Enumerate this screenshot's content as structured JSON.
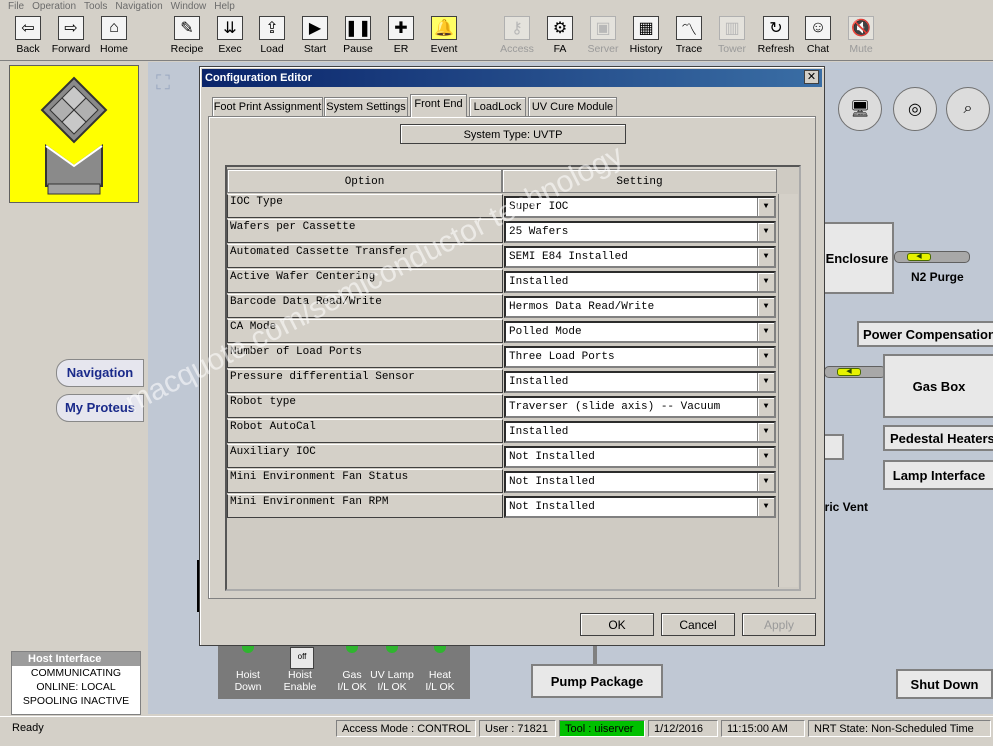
{
  "menu": [
    "File",
    "Operation",
    "Tools",
    "Navigation",
    "Window",
    "Help"
  ],
  "toolbar": [
    {
      "label": "Back",
      "icon": "arrow-left-icon",
      "glyph": "⇦",
      "enabled": true
    },
    {
      "label": "Forward",
      "icon": "arrow-right-icon",
      "glyph": "⇨",
      "enabled": true
    },
    {
      "label": "Home",
      "icon": "home-icon",
      "glyph": "⌂",
      "enabled": true
    },
    {
      "label": "Recipe",
      "icon": "recipe-icon",
      "glyph": "✎",
      "enabled": true
    },
    {
      "label": "Exec",
      "icon": "exec-icon",
      "glyph": "⇊",
      "enabled": true
    },
    {
      "label": "Load",
      "icon": "load-icon",
      "glyph": "⇪",
      "enabled": true
    },
    {
      "label": "Start",
      "icon": "play-icon",
      "glyph": "▶",
      "enabled": true
    },
    {
      "label": "Pause",
      "icon": "pause-icon",
      "glyph": "❚❚",
      "enabled": true
    },
    {
      "label": "ER",
      "icon": "plus-icon",
      "glyph": "✚",
      "enabled": true
    },
    {
      "label": "Event",
      "icon": "bell-icon",
      "glyph": "🔔",
      "enabled": true
    },
    {
      "label": "Access",
      "icon": "key-icon",
      "glyph": "⚷",
      "enabled": false
    },
    {
      "label": "FA",
      "icon": "gear-icon",
      "glyph": "⚙",
      "enabled": true
    },
    {
      "label": "Server",
      "icon": "server-icon",
      "glyph": "▣",
      "enabled": false
    },
    {
      "label": "History",
      "icon": "history-icon",
      "glyph": "▦",
      "enabled": true
    },
    {
      "label": "Trace",
      "icon": "trace-icon",
      "glyph": "〽",
      "enabled": true
    },
    {
      "label": "Tower",
      "icon": "tower-icon",
      "glyph": "▥",
      "enabled": false
    },
    {
      "label": "Refresh",
      "icon": "refresh-icon",
      "glyph": "↻",
      "enabled": true
    },
    {
      "label": "Chat",
      "icon": "chat-icon",
      "glyph": "☺",
      "enabled": true
    },
    {
      "label": "Mute",
      "icon": "mute-icon",
      "glyph": "🔇",
      "enabled": false
    }
  ],
  "left": {
    "nav_buttons": [
      "Navigation",
      "My Proteus"
    ],
    "host_interface": {
      "title": "Host Interface",
      "lines": [
        "COMMUNICATING",
        "ONLINE: LOCAL",
        "SPOOLING INACTIVE"
      ]
    }
  },
  "background": {
    "buttons": [
      "Enclosure",
      "Power Compensation",
      "Gas Box",
      "Pedestal Heaters",
      "Lamp Interface",
      "Pump Package",
      "Shut Down"
    ],
    "labels": [
      "N2 Purge",
      "eric Vent"
    ],
    "leds": [
      {
        "label": "Hoist\nDown"
      },
      {
        "label": "Hoist\nEnable",
        "toggle": "off"
      },
      {
        "label": "Gas\nI/L OK"
      },
      {
        "label": "UV Lamp\nI/L OK"
      },
      {
        "label": "Heat\nI/L OK"
      }
    ]
  },
  "dialog": {
    "title": "Configuration Editor",
    "tabs": [
      "Foot Print Assignment",
      "System Settings",
      "Front End",
      "LoadLock",
      "UV Cure Module"
    ],
    "active_tab": 2,
    "system_type": "System Type: UVTP",
    "columns": [
      "Option",
      "Setting"
    ],
    "rows": [
      {
        "option": "IOC Type",
        "setting": "Super IOC"
      },
      {
        "option": "Wafers per Cassette",
        "setting": "25 Wafers"
      },
      {
        "option": "Automated Cassette Transfer",
        "setting": "SEMI E84 Installed"
      },
      {
        "option": "Active Wafer Centering",
        "setting": "Installed"
      },
      {
        "option": "Barcode Data Read/Write",
        "setting": "Hermos Data Read/Write"
      },
      {
        "option": "CA Mode",
        "setting": "Polled Mode"
      },
      {
        "option": "Number of Load Ports",
        "setting": "Three Load Ports"
      },
      {
        "option": "Pressure differential Sensor",
        "setting": "Installed"
      },
      {
        "option": "Robot type",
        "setting": "Traverser (slide axis) -- Vacuum"
      },
      {
        "option": "Robot AutoCal",
        "setting": "Installed"
      },
      {
        "option": "Auxiliary IOC",
        "setting": "Not Installed"
      },
      {
        "option": "Mini Environment Fan Status",
        "setting": "Not Installed"
      },
      {
        "option": "Mini Environment Fan RPM",
        "setting": "Not Installed"
      }
    ],
    "buttons": {
      "ok": "OK",
      "cancel": "Cancel",
      "apply": "Apply"
    }
  },
  "status": {
    "ready": "Ready",
    "access_mode": "Access Mode : CONTROL",
    "user": "User :  71821",
    "tool": "Tool :   uiserver",
    "date": "1/12/2016",
    "time": "11:15:00 AM",
    "nrt": "NRT State: Non-Scheduled Time"
  },
  "colors": {
    "logo_bg": "#ffff00",
    "title_bar": "#0a246a",
    "tool_status": "#00c000",
    "led_on": "#2fb52f"
  },
  "watermark": "macquote.com/semiconductor technology"
}
